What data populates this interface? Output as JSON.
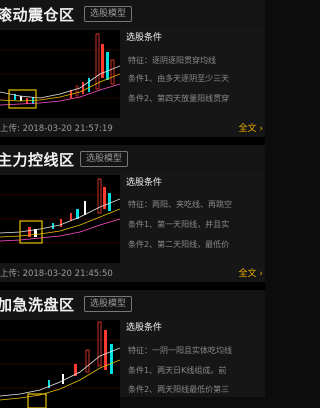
{
  "cards": [
    {
      "title": "滚动震仓区",
      "tag": "选股模型",
      "cond_title": "选股条件",
      "rows": [
        "特征：逐阴逐阳贯穿均线",
        "条件1、由多天逐阴至少三天",
        "条件2、第四天放量阳线贯穿"
      ],
      "updated": "上传: 2018-03-20 21:57:19",
      "more": "全文 ›"
    },
    {
      "title": "主力控线区",
      "tag": "选股模型",
      "cond_title": "选股条件",
      "rows": [
        "特征：两阳、夹吃线、再跳空",
        "条件1、第一天阳线，并且实",
        "条件2、第二天阳线，最低价"
      ],
      "updated": "上传: 2018-03-20 21:45:50",
      "more": "全文 ›"
    },
    {
      "title": "加急洗盘区",
      "tag": "选股模型",
      "cond_title": "选股条件",
      "rows": [
        "特征：一阴一阳且实体吃均线",
        "条件1、两天日K线组成。前",
        "条件2、两天阳线最低价第三"
      ],
      "updated": "",
      "more": ""
    }
  ],
  "colors": {
    "accent": "#f0b000",
    "bull": "#ff3b30",
    "bear": "#00e0e0",
    "highlight_box": "#e8c000"
  }
}
